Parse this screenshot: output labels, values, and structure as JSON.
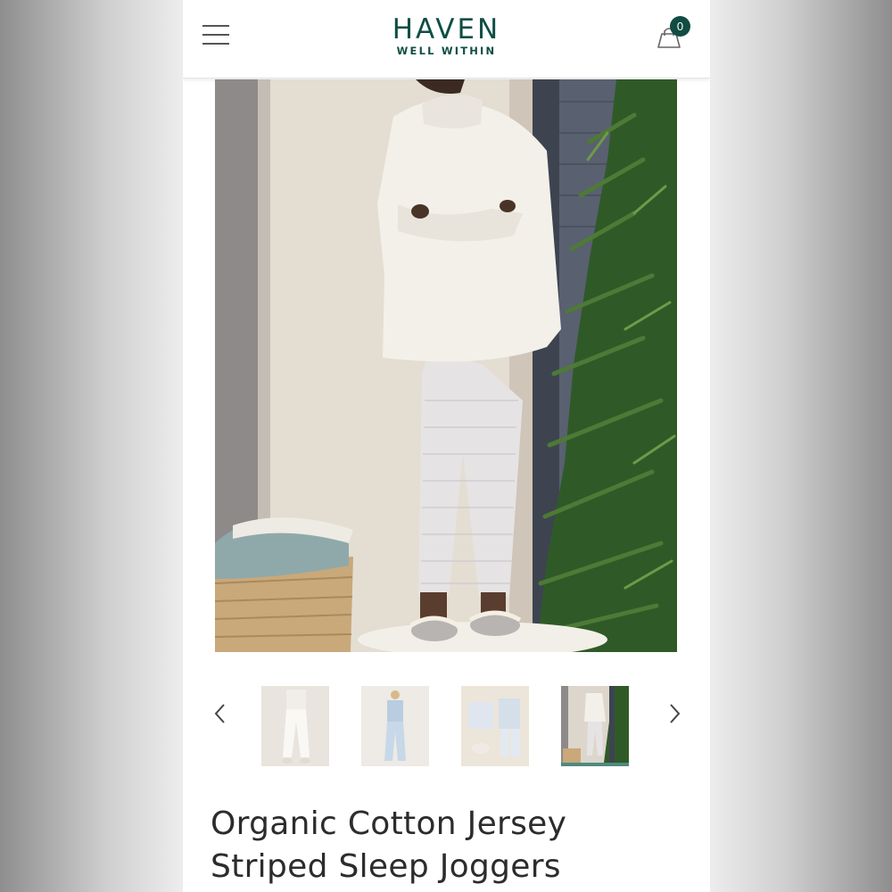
{
  "header": {
    "brand_name": "HAVEN",
    "brand_tagline": "WELL WITHIN",
    "menu_icon": "hamburger-menu-icon",
    "cart_icon": "shopping-bag-icon",
    "cart_count": "0",
    "accent_color": "#0f4e44"
  },
  "gallery": {
    "main_image": "model in white sherpa pullover and striped sleep joggers beside basket and pine tree",
    "thumbnails": [
      {
        "icon": "thumbnail-white-joggers-front",
        "active": false
      },
      {
        "icon": "thumbnail-blue-striped-set",
        "active": false
      },
      {
        "icon": "thumbnail-flat-lay-pajama-set",
        "active": false
      },
      {
        "icon": "thumbnail-model-with-pine-tree",
        "active": true
      }
    ],
    "prev_icon": "chevron-left-icon",
    "next_icon": "chevron-right-icon",
    "active_indicator_color": "#4f8a7e"
  },
  "product": {
    "title_line1": "Organic Cotton Jersey",
    "title_line2": "Striped Sleep Joggers"
  }
}
